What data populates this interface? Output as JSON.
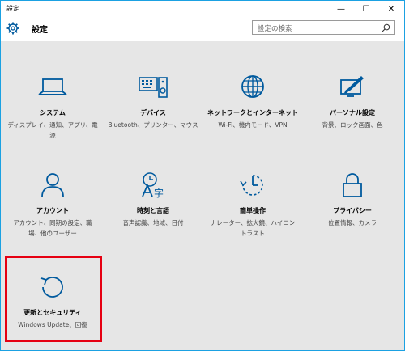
{
  "window": {
    "title": "設定",
    "minimize_glyph": "—",
    "maximize_glyph": "☐",
    "close_glyph": "✕"
  },
  "header": {
    "title": "設定",
    "search_placeholder": "設定の検索"
  },
  "tiles": [
    {
      "label": "システム",
      "desc": "ディスプレイ、通知、アプリ、電源",
      "icon": "laptop-icon"
    },
    {
      "label": "デバイス",
      "desc": "Bluetooth、プリンター、マウス",
      "icon": "keyboard-speaker-icon"
    },
    {
      "label": "ネットワークとインターネット",
      "desc": "Wi-Fi、機内モード、VPN",
      "icon": "globe-icon"
    },
    {
      "label": "パーソナル設定",
      "desc": "背景、ロック画面、色",
      "icon": "paint-monitor-icon"
    },
    {
      "label": "アカウント",
      "desc": "アカウント、同期の設定、職場、他のユーザー",
      "icon": "person-icon"
    },
    {
      "label": "時刻と言語",
      "desc": "音声認識、地域、日付",
      "icon": "clock-language-icon"
    },
    {
      "label": "簡単操作",
      "desc": "ナレーター、拡大鏡、ハイコントラスト",
      "icon": "ease-of-access-icon"
    },
    {
      "label": "プライバシー",
      "desc": "位置情報、カメラ",
      "icon": "lock-icon"
    },
    {
      "label": "更新とセキュリティ",
      "desc": "Windows Update、回復",
      "icon": "refresh-icon"
    }
  ],
  "colors": {
    "accent": "#005a9e",
    "highlight": "#e60012",
    "window_border": "#1ba1e2"
  }
}
